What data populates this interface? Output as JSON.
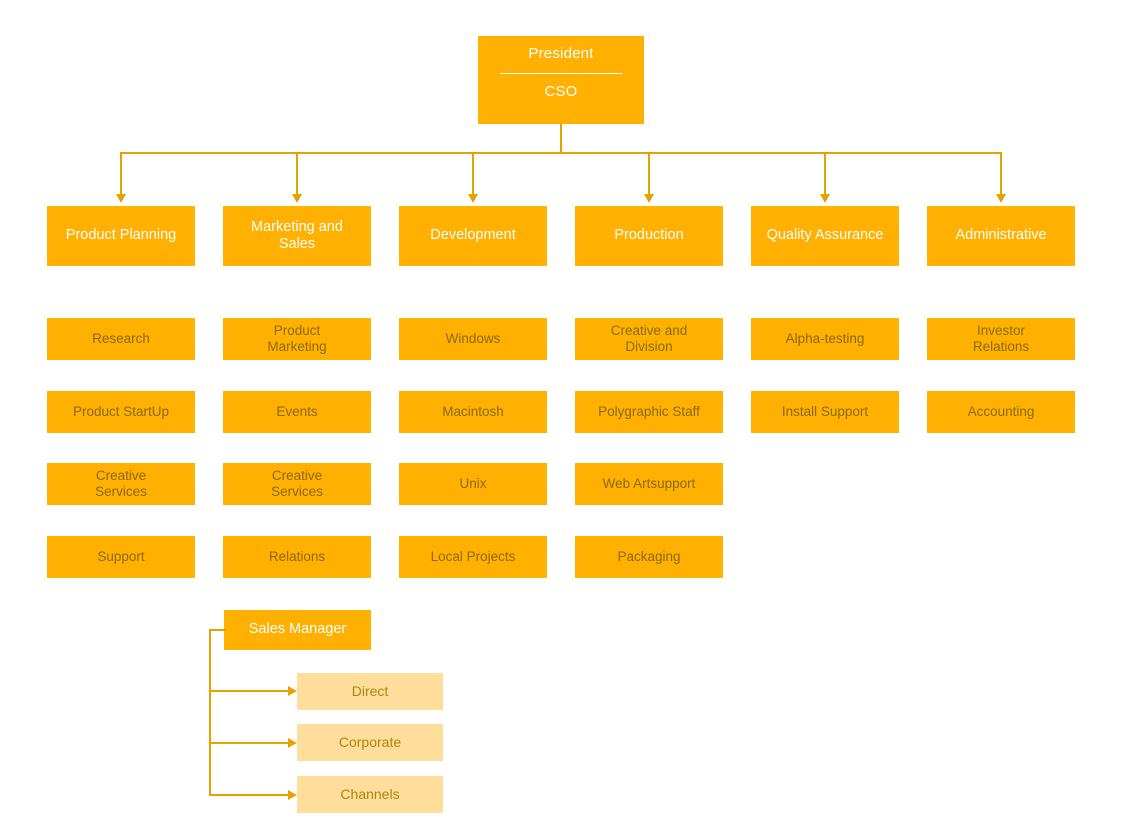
{
  "chart_data": {
    "type": "diagram",
    "title": "Organizational Chart",
    "colors": {
      "primary": "#FFB000",
      "leaf": "#FFDE9B",
      "connector": "#E8A200",
      "header_text": "#FFFFFF",
      "unit_text": "#8A6B08",
      "leaf_text": "#B1820C",
      "background": "#FFFFFF"
    }
  },
  "root": {
    "title": "President",
    "subtitle": "CSO"
  },
  "departments": [
    {
      "label": "Product Planning",
      "units": [
        "Research",
        "Product StartUp",
        "Creative\nServices",
        "Support"
      ]
    },
    {
      "label": "Marketing and\nSales",
      "units": [
        "Product\nMarketing",
        "Events",
        "Creative\nServices",
        "Relations"
      ]
    },
    {
      "label": "Development",
      "units": [
        "Windows",
        "Macintosh",
        "Unix",
        "Local Projects"
      ]
    },
    {
      "label": "Production",
      "units": [
        "Creative and\nDivision",
        "Polygraphic Staff",
        "Web Artsupport",
        "Packaging"
      ]
    },
    {
      "label": "Quality Assurance",
      "units": [
        "Alpha-testing",
        "Install Support"
      ]
    },
    {
      "label": "Administrative",
      "units": [
        "Investor\nRelations",
        "Accounting"
      ]
    }
  ],
  "sales_branch": {
    "manager": "Sales Manager",
    "channels": [
      "Direct",
      "Corporate",
      "Channels"
    ]
  }
}
